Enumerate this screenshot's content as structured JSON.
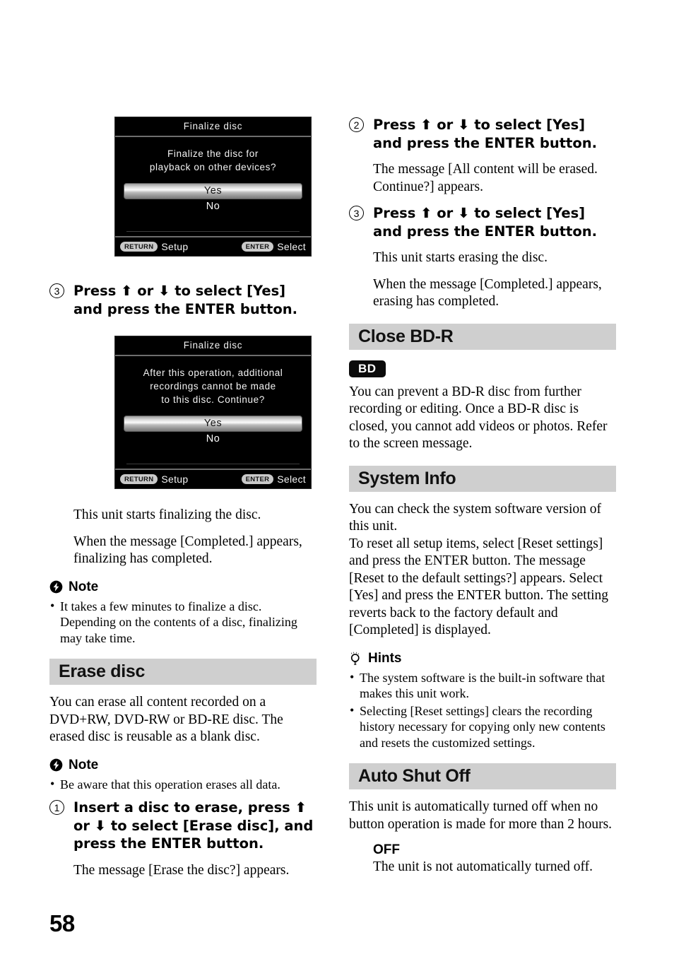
{
  "page": {
    "number": "58"
  },
  "dialogs": [
    {
      "name": "finalize-disc-confirm",
      "title": "Finalize  disc",
      "message_lines": [
        "Finalize  the  disc  for",
        "playback  on  other  devices?"
      ],
      "options": [
        "Yes",
        "No"
      ],
      "selected": "Yes",
      "footer": {
        "left_key": "RETURN",
        "left_label": "Setup",
        "right_key": "ENTER",
        "right_label": "Select"
      }
    },
    {
      "name": "finalize-disc-warning",
      "title": "Finalize  disc",
      "message_lines": [
        "After  this  operation,  additional",
        "recordings  cannot  be  made",
        "to  this  disc. Continue?"
      ],
      "options": [
        "Yes",
        "No"
      ],
      "selected": "Yes",
      "footer": {
        "left_key": "RETURN",
        "left_label": "Setup",
        "right_key": "ENTER",
        "right_label": "Select"
      }
    }
  ],
  "left_column": {
    "step3_finalize": {
      "num": "3",
      "text": "Press ⬆ or ⬇ to select [Yes] and press the ENTER button."
    },
    "after_finalize": {
      "line1": "This unit starts finalizing the disc.",
      "line2": "When the message [Completed.] appears, finalizing has completed."
    },
    "note_finalize": {
      "heading": "Note",
      "icon": "note-lightning-icon",
      "items": [
        "It takes a few minutes to finalize a disc. Depending on the contents of a disc, finalizing may take time."
      ]
    },
    "erase_disc": {
      "heading": "Erase disc",
      "body": "You can erase all content recorded on a DVD+RW, DVD-RW or BD-RE disc. The erased disc is reusable as a blank disc.",
      "note": {
        "heading": "Note",
        "icon": "note-lightning-icon",
        "items": [
          "Be aware that this operation erases all data."
        ]
      },
      "step1": {
        "num": "1",
        "text": "Insert a disc to erase, press ⬆ or ⬇ to select [Erase disc], and press the ENTER button."
      },
      "step1_result": "The message [Erase the disc?] appears."
    }
  },
  "right_column": {
    "step2_erase": {
      "num": "2",
      "text": "Press ⬆ or ⬇ to select [Yes] and press the ENTER button."
    },
    "step2_result": "The message [All content will be erased. Continue?] appears.",
    "step3_erase": {
      "num": "3",
      "text": "Press ⬆ or ⬇ to select [Yes] and press the ENTER button."
    },
    "step3_result_1": "This unit starts erasing the disc.",
    "step3_result_2": "When the message [Completed.] appears, erasing has completed.",
    "close_bdr": {
      "heading": "Close BD-R",
      "badge": "BD",
      "body": "You can prevent a BD-R disc from further recording or editing. Once a BD-R disc is closed, you cannot add videos or photos. Refer to the screen message."
    },
    "system_info": {
      "heading": "System Info",
      "body": "You can check the system software version of this unit.\nTo reset all setup items, select [Reset settings] and press the ENTER button. The message [Reset to the default settings?] appears. Select [Yes] and press the ENTER button. The setting reverts back to the factory default and [Completed] is displayed.",
      "hints": {
        "heading": "Hints",
        "icon": "hint-lightbulb-icon",
        "items": [
          "The system software is the built-in software that makes this unit work.",
          "Selecting [Reset settings] clears the recording history necessary for copying only new contents and resets the customized settings."
        ]
      }
    },
    "auto_shut_off": {
      "heading": "Auto Shut Off",
      "body": "This unit is automatically turned off when no button operation is made for more than 2 hours.",
      "option": {
        "name": "OFF",
        "description": "The unit is not automatically turned off."
      }
    }
  },
  "colors": {
    "section_bar": "#cfcfcf",
    "badge_bg": "#0b0b0b",
    "screen_bg": "#000000"
  }
}
